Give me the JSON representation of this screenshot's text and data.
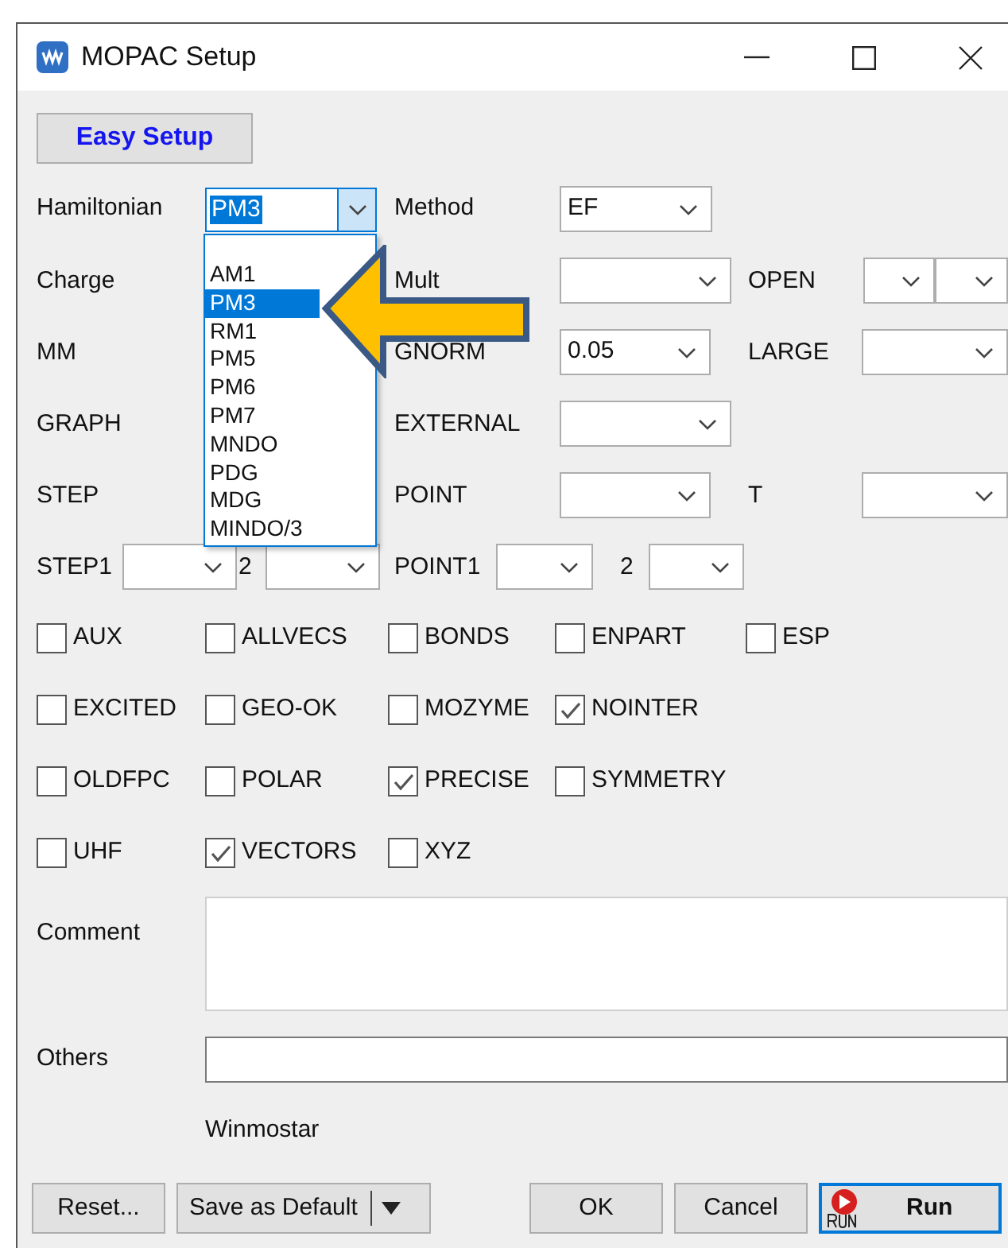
{
  "window": {
    "title": "MOPAC Setup"
  },
  "easy_setup_button": "Easy Setup",
  "hamiltonian": {
    "label": "Hamiltonian",
    "value": "PM3",
    "expanded": true,
    "options": [
      {
        "label": "AM1",
        "selected": false
      },
      {
        "label": "PM3",
        "selected": true
      },
      {
        "label": "RM1",
        "selected": false
      },
      {
        "label": "PM5",
        "selected": false
      },
      {
        "label": "PM6",
        "selected": false
      },
      {
        "label": "PM7",
        "selected": false
      },
      {
        "label": "MNDO",
        "selected": false
      },
      {
        "label": "PDG",
        "selected": false
      },
      {
        "label": "MDG",
        "selected": false
      },
      {
        "label": "MINDO/3",
        "selected": false
      }
    ]
  },
  "method": {
    "label": "Method",
    "value": "EF"
  },
  "rows": [
    [
      {
        "label": "Charge",
        "kind": "label"
      },
      {
        "label": "Mult",
        "kind": "combo"
      },
      {
        "label": "OPEN",
        "kind": "double_combo"
      }
    ],
    [
      {
        "label": "MM",
        "kind": "label"
      },
      {
        "label": "GNORM",
        "kind": "combo",
        "value": "0.05"
      },
      {
        "label": "LARGE",
        "kind": "combo"
      }
    ],
    [
      {
        "label": "GRAPH",
        "kind": "label"
      },
      {
        "label": "EXTERNAL",
        "kind": "combo"
      }
    ],
    [
      {
        "label": "STEP",
        "kind": "label"
      },
      {
        "label": "POINT",
        "kind": "combo"
      },
      {
        "label": "T",
        "kind": "combo"
      }
    ],
    [
      {
        "label": "STEP1",
        "kind": "combo"
      },
      {
        "label": "2",
        "kind": "combo"
      },
      {
        "label": "POINT1",
        "kind": "combo"
      },
      {
        "label": "2",
        "kind": "combo"
      }
    ]
  ],
  "options": [
    [
      {
        "label": "AUX",
        "checked": false
      },
      {
        "label": "ALLVECS",
        "checked": false
      },
      {
        "label": "BONDS",
        "checked": false
      },
      {
        "label": "ENPART",
        "checked": false
      },
      {
        "label": "ESP",
        "checked": false
      }
    ],
    [
      {
        "label": "EXCITED",
        "checked": false
      },
      {
        "label": "GEO-OK",
        "checked": false
      },
      {
        "label": "MOZYME",
        "checked": false
      },
      {
        "label": "NOINTER",
        "checked": true
      }
    ],
    [
      {
        "label": "OLDFPC",
        "checked": false
      },
      {
        "label": "POLAR",
        "checked": false
      },
      {
        "label": "PRECISE",
        "checked": true
      },
      {
        "label": "SYMMETRY",
        "checked": false
      }
    ],
    [
      {
        "label": "UHF",
        "checked": false
      },
      {
        "label": "VECTORS",
        "checked": true
      },
      {
        "label": "XYZ",
        "checked": false
      }
    ]
  ],
  "comment": {
    "label": "Comment"
  },
  "others": {
    "label": "Others"
  },
  "footer": "Winmostar",
  "buttons": [
    {
      "label": "Reset...",
      "kind": "plain"
    },
    {
      "label": "Save as Default",
      "kind": "split"
    },
    {
      "label": "OK",
      "kind": "plain"
    },
    {
      "label": "Cancel",
      "kind": "plain"
    },
    {
      "label": "Run",
      "kind": "run"
    }
  ]
}
